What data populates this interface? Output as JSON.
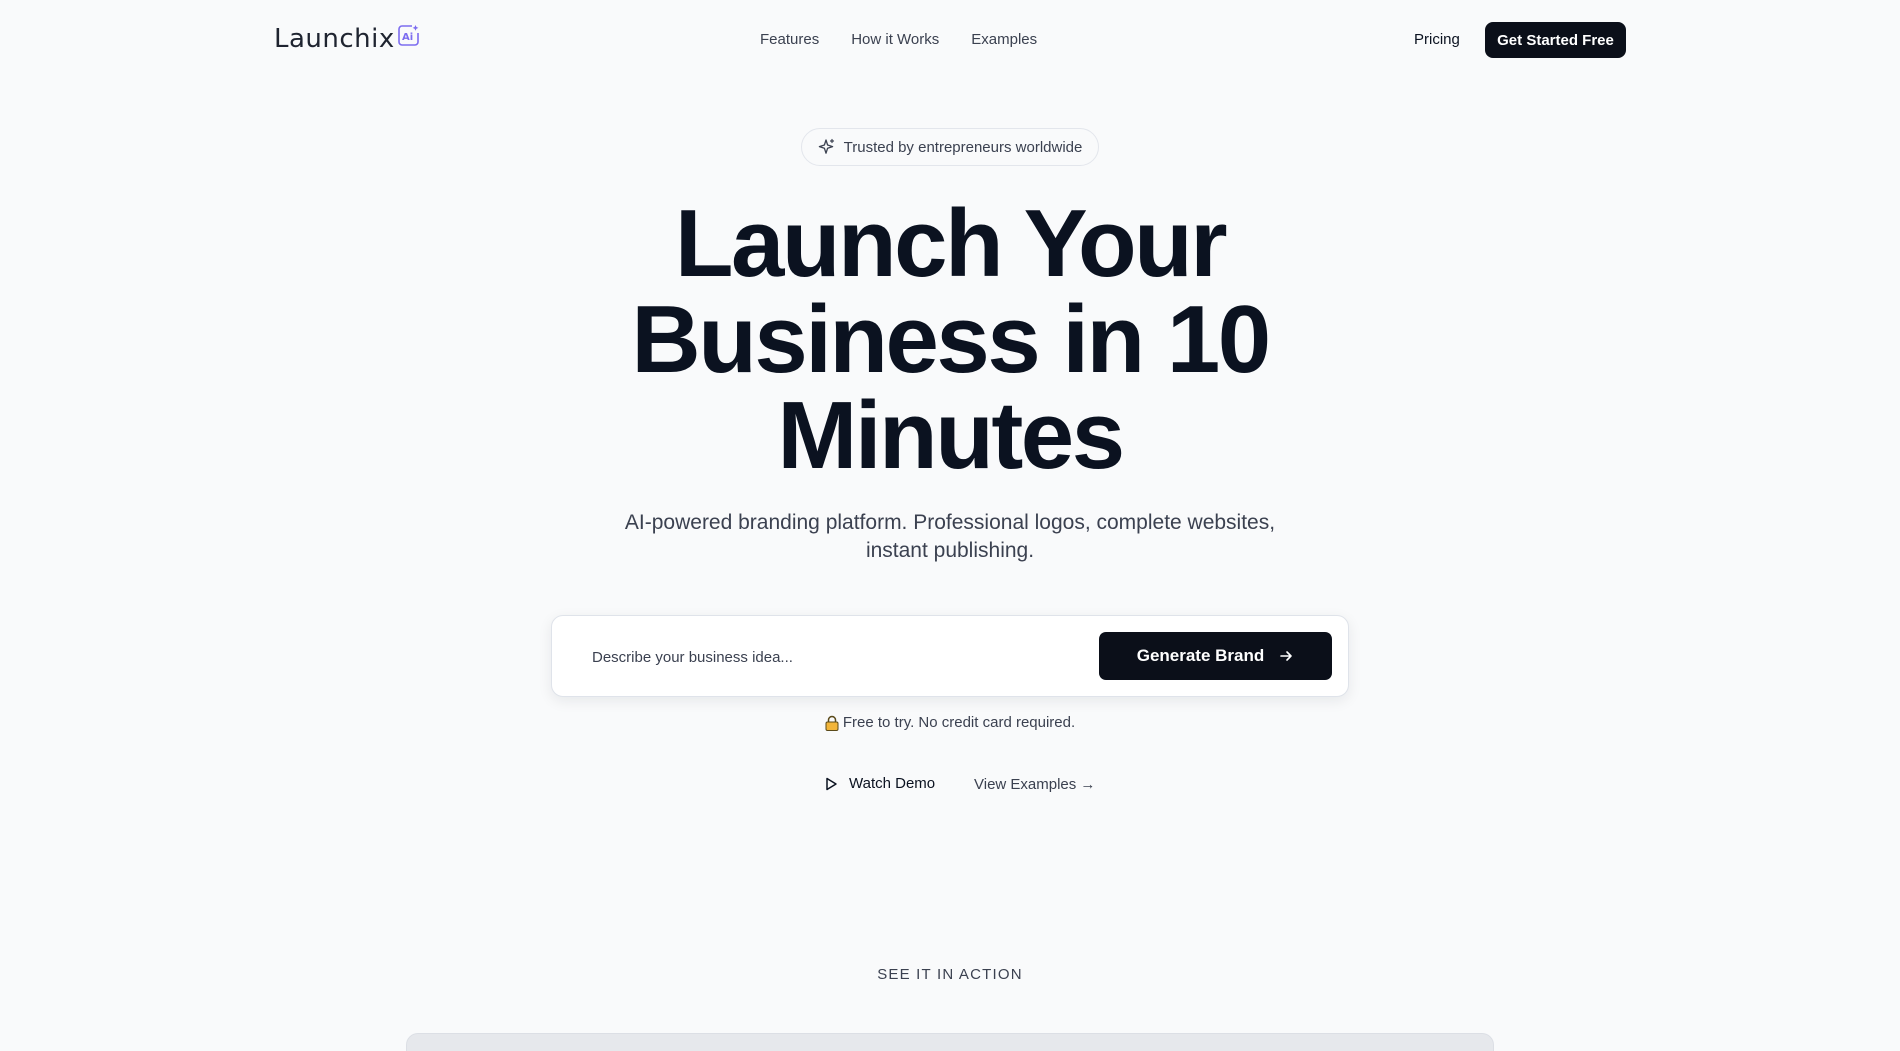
{
  "nav": {
    "logo_text": "Launchix",
    "logo_badge": "Ai",
    "links": [
      "Features",
      "How it Works",
      "Examples"
    ],
    "pricing": "Pricing",
    "cta": "Get Started Free"
  },
  "badge": {
    "text": "Trusted by entrepreneurs worldwide",
    "icon": "sparkle-icon"
  },
  "hero": {
    "title_lines": [
      "Launch Your",
      "Business in 10",
      "Minutes"
    ],
    "subtitle": "AI-powered branding platform. Professional logos, complete websites, instant publishing."
  },
  "generator": {
    "placeholder": "Describe your business idea...",
    "value": "",
    "button": "Generate Brand"
  },
  "free_note": "Free to try. No credit card required.",
  "actions": {
    "watch_demo": "Watch Demo",
    "view_examples": "View Examples →"
  },
  "section_label": "SEE IT IN ACTION",
  "colors": {
    "background": "#f9fafb",
    "primary": "#0b0f19",
    "text": "#0b1220",
    "muted": "#3b4150",
    "logo_accent": "#7c6cf0"
  }
}
